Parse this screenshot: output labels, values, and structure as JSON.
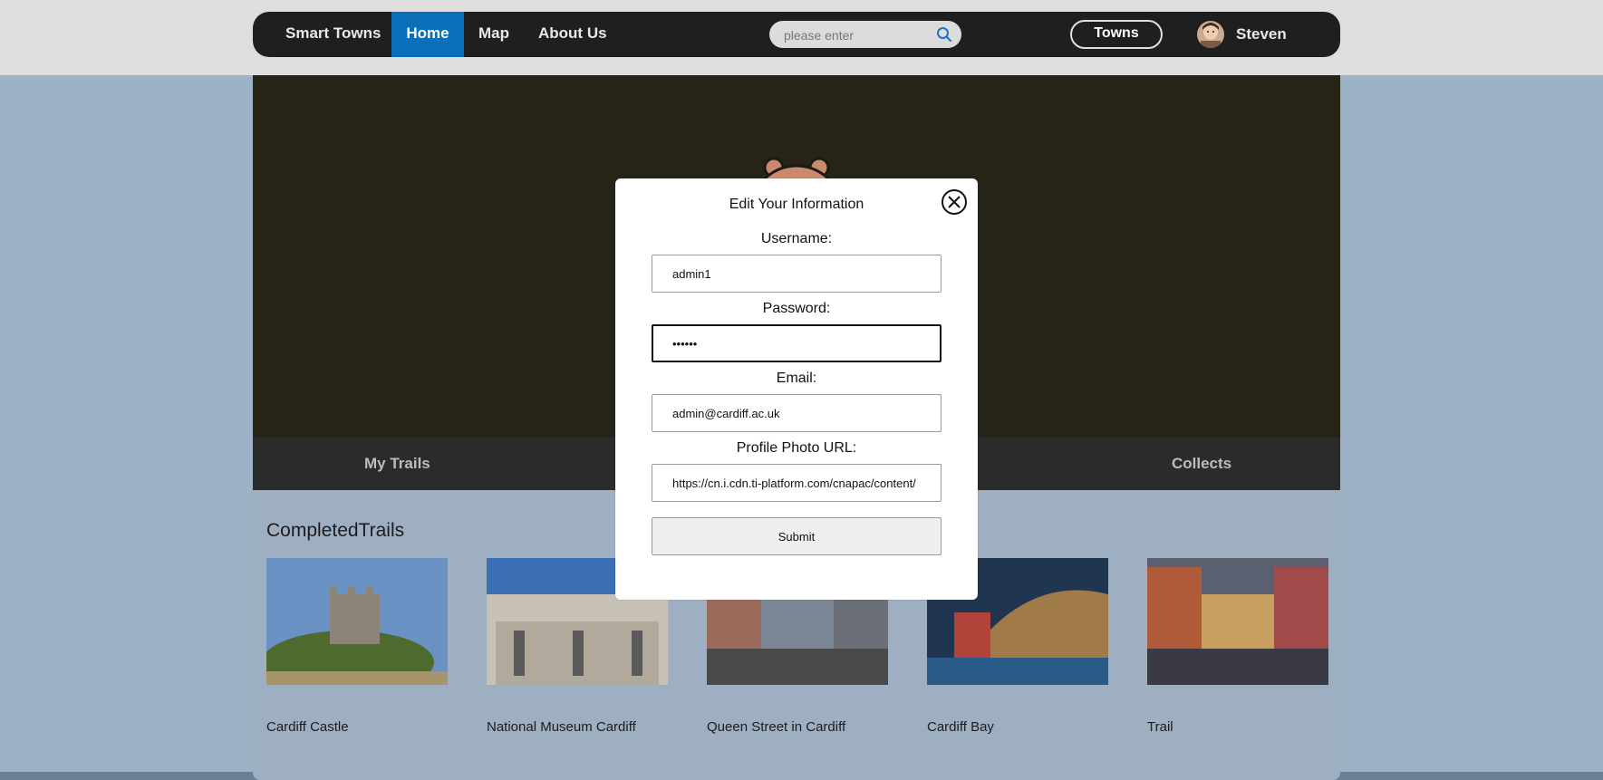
{
  "navbar": {
    "brand": "Smart Towns",
    "links": [
      "Home",
      "Map",
      "About Us"
    ],
    "active_link": "Home",
    "search_placeholder": "please enter",
    "towns_button": "Towns",
    "user_name": "Steven"
  },
  "tabs": [
    "My Trails",
    "Collects"
  ],
  "section": {
    "title": "CompletedTrails",
    "cards": [
      {
        "title": "Cardiff Castle"
      },
      {
        "title": "National Museum Cardiff"
      },
      {
        "title": "Queen Street in Cardiff"
      },
      {
        "title": "Cardiff Bay"
      },
      {
        "title": "Trail"
      }
    ]
  },
  "modal": {
    "title": "Edit Your Information",
    "username_label": "Username:",
    "username_value": "admin1",
    "password_label": "Password:",
    "password_value": "••••••",
    "email_label": "Email:",
    "email_value": "admin@cardiff.ac.uk",
    "photo_label": "Profile Photo URL:",
    "photo_value": "https://cn.i.cdn.ti-platform.com/cnapac/content/",
    "submit_label": "Submit"
  },
  "colors": {
    "accent": "#0a6fb8",
    "navbar": "#1f1f1f",
    "overlay": "#9eb2c7"
  }
}
